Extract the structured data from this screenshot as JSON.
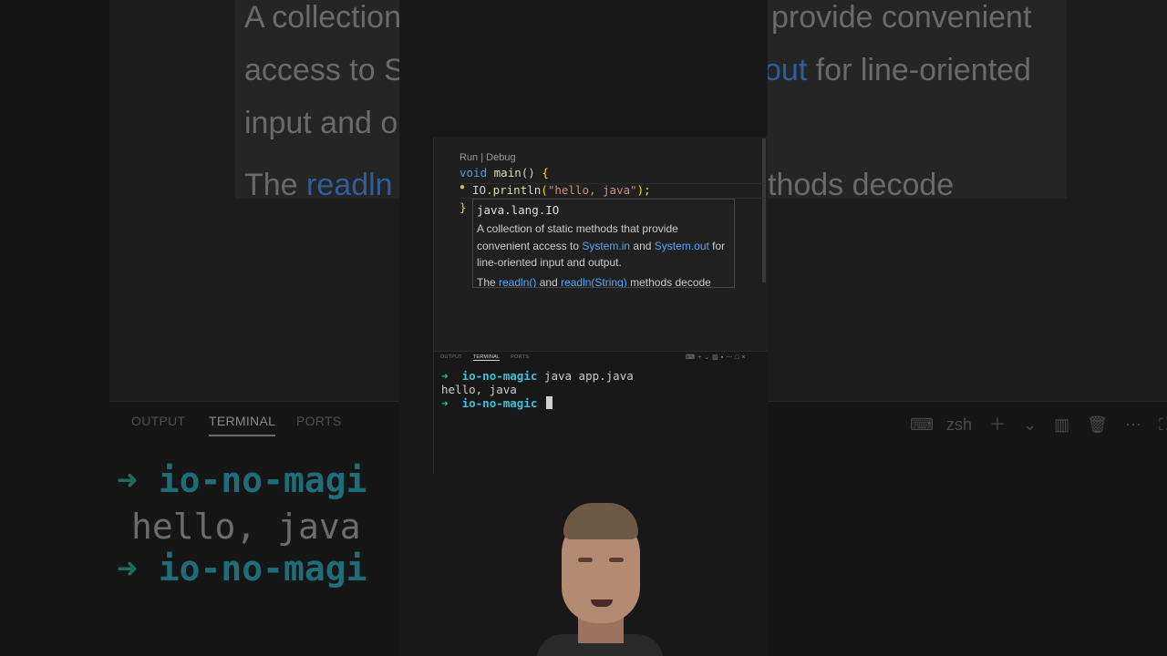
{
  "editor": {
    "codelens": "Run | Debug",
    "line1": {
      "kw": "void",
      "fn": "main",
      "rest": "()",
      "brace": "{"
    },
    "line2": {
      "obj": "IO",
      "dot": ".",
      "method": "println",
      "open": "(",
      "str": "\"hello, java\"",
      "close": ");"
    },
    "line3": {
      "brace": "}"
    }
  },
  "hover": {
    "title": "java.lang.IO",
    "desc_a": "A collection of static methods that provide convenient access to ",
    "link_system_in": "System.in",
    "desc_and": " and ",
    "link_system_out": "System.out",
    "desc_b": " for line-oriented input and output.",
    "desc2_a": "The ",
    "link_readln": "readln()",
    "desc2_and": " and ",
    "link_readln_string": "readln(String)",
    "desc2_b": " methods decode"
  },
  "panel": {
    "tabs": [
      "OUTPUT",
      "TERMINAL",
      "PORTS"
    ],
    "active_tab": "TERMINAL",
    "shell": "zsh"
  },
  "terminal": {
    "prompt_arrow": "➜",
    "dir": "io-no-magic",
    "command": "java app.java",
    "output": "hello, java"
  },
  "background_zoom": {
    "line1": "A collection",
    "line1b": "provide convenient",
    "line2": "access to S",
    "line2_link": "out",
    "line2b": "for line-oriented",
    "line3": "input and o",
    "line4a": "The ",
    "line4_link": "readln",
    "line4b": "thods decode",
    "term_dir": "io-no-magi",
    "term_output": "hello, java"
  },
  "colors": {
    "accent_link": "#4daafc",
    "prompt_green": "#2ec27e",
    "dir_cyan": "#3fc1d9",
    "string": "#ce9178",
    "keyword": "#569cd6"
  }
}
